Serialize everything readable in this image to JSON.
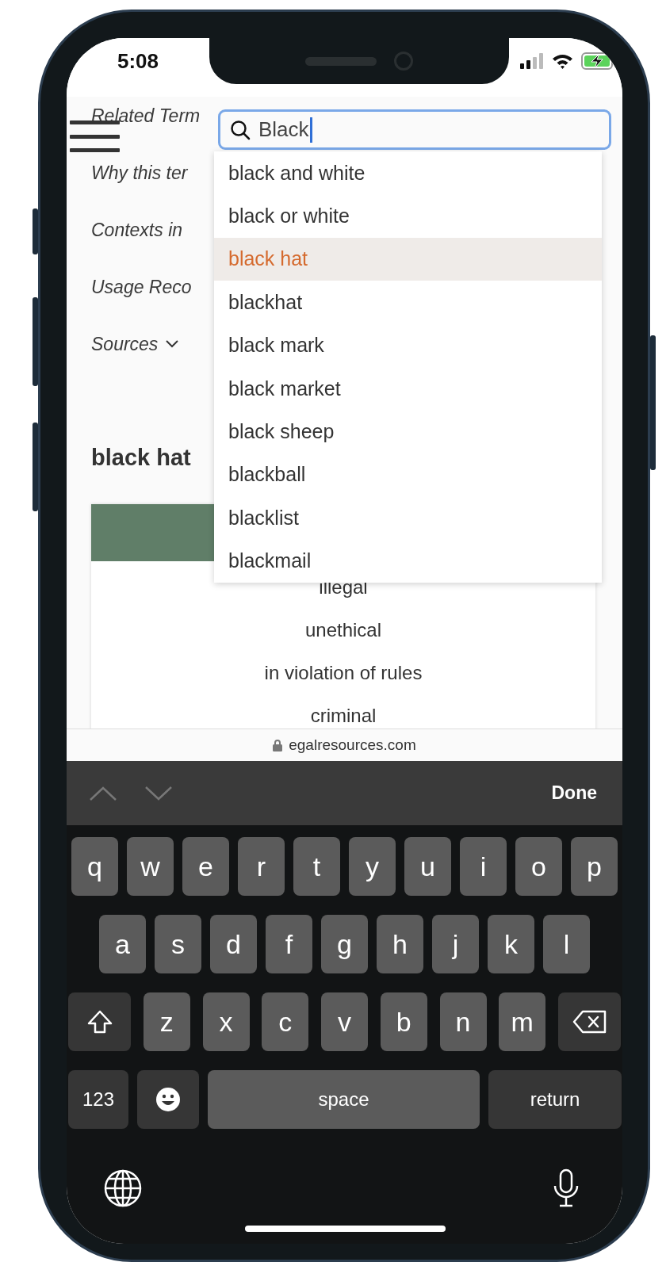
{
  "status_bar": {
    "time": "5:08",
    "charging": true
  },
  "page": {
    "nav_links": [
      {
        "label": "Related Term"
      },
      {
        "label": "Why this ter"
      },
      {
        "label": "Contexts in"
      },
      {
        "label": "Usage Reco"
      }
    ],
    "sources": {
      "label": "Sources",
      "expanded": false
    },
    "heading": "black hat",
    "table_rows": [
      "illegal",
      "unethical",
      "in violation of rules",
      "criminal"
    ]
  },
  "search": {
    "value": "Black"
  },
  "suggestions": [
    {
      "label": "black and white",
      "selected": false
    },
    {
      "label": "black or white",
      "selected": false
    },
    {
      "label": "black hat",
      "selected": true
    },
    {
      "label": "blackhat",
      "selected": false
    },
    {
      "label": "black mark",
      "selected": false
    },
    {
      "label": "black market",
      "selected": false
    },
    {
      "label": "black sheep",
      "selected": false
    },
    {
      "label": "blackball",
      "selected": false
    },
    {
      "label": "blacklist",
      "selected": false
    },
    {
      "label": "blackmail",
      "selected": false
    }
  ],
  "url_bar": {
    "domain": "egalresources.com",
    "secure": true
  },
  "keyboard_toolbar": {
    "done": "Done"
  },
  "keyboard": {
    "rows": [
      {
        "keys": [
          {
            "kind": "letter",
            "label": "q"
          },
          {
            "kind": "letter",
            "label": "w"
          },
          {
            "kind": "letter",
            "label": "e"
          },
          {
            "kind": "letter",
            "label": "r"
          },
          {
            "kind": "letter",
            "label": "t"
          },
          {
            "kind": "letter",
            "label": "y"
          },
          {
            "kind": "letter",
            "label": "u"
          },
          {
            "kind": "letter",
            "label": "i"
          },
          {
            "kind": "letter",
            "label": "o"
          },
          {
            "kind": "letter",
            "label": "p"
          }
        ]
      },
      {
        "keys": [
          {
            "kind": "letter",
            "label": "a"
          },
          {
            "kind": "letter",
            "label": "s"
          },
          {
            "kind": "letter",
            "label": "d"
          },
          {
            "kind": "letter",
            "label": "f"
          },
          {
            "kind": "letter",
            "label": "g"
          },
          {
            "kind": "letter",
            "label": "h"
          },
          {
            "kind": "letter",
            "label": "j"
          },
          {
            "kind": "letter",
            "label": "k"
          },
          {
            "kind": "letter",
            "label": "l"
          }
        ]
      },
      {
        "keys": [
          {
            "kind": "shift"
          },
          {
            "kind": "letter",
            "label": "z"
          },
          {
            "kind": "letter",
            "label": "x"
          },
          {
            "kind": "letter",
            "label": "c"
          },
          {
            "kind": "letter",
            "label": "v"
          },
          {
            "kind": "letter",
            "label": "b"
          },
          {
            "kind": "letter",
            "label": "n"
          },
          {
            "kind": "letter",
            "label": "m"
          },
          {
            "kind": "delete"
          }
        ]
      },
      {
        "keys": [
          {
            "kind": "numbers",
            "label": "123"
          },
          {
            "kind": "emoji"
          },
          {
            "kind": "space",
            "label": "space"
          },
          {
            "kind": "return",
            "label": "return"
          }
        ]
      }
    ]
  }
}
